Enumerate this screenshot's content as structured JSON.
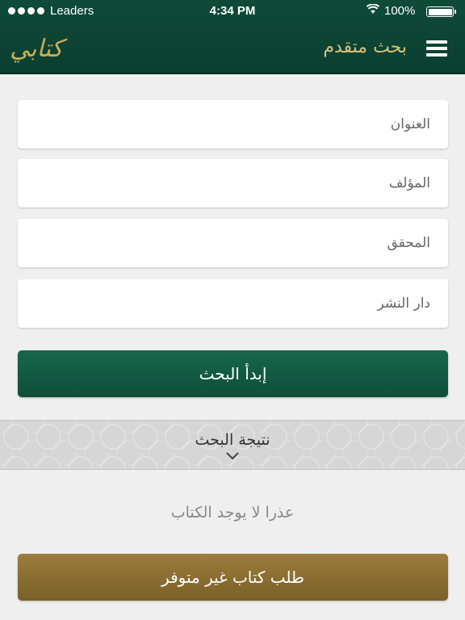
{
  "status_bar": {
    "carrier": "Leaders",
    "time": "4:34 PM",
    "battery": "100%"
  },
  "header": {
    "logo_text": "كتابي",
    "title": "بحث متقدم",
    "menu_icon": "hamburger-icon"
  },
  "form": {
    "title_placeholder": "العنوان",
    "author_placeholder": "المؤلف",
    "editor_placeholder": "المحقق",
    "publisher_placeholder": "دار النشر",
    "search_button": "إبدأ البحث"
  },
  "results": {
    "label": "نتيجة البحث",
    "empty_message": "عذرا لا يوجد الكتاب",
    "request_button": "طلب كتاب غير متوفر"
  },
  "colors": {
    "header_green": "#0f4a39",
    "accent_gold": "#c9ad5a",
    "button_green": "#17664d",
    "button_gold": "#9c7d3c"
  }
}
